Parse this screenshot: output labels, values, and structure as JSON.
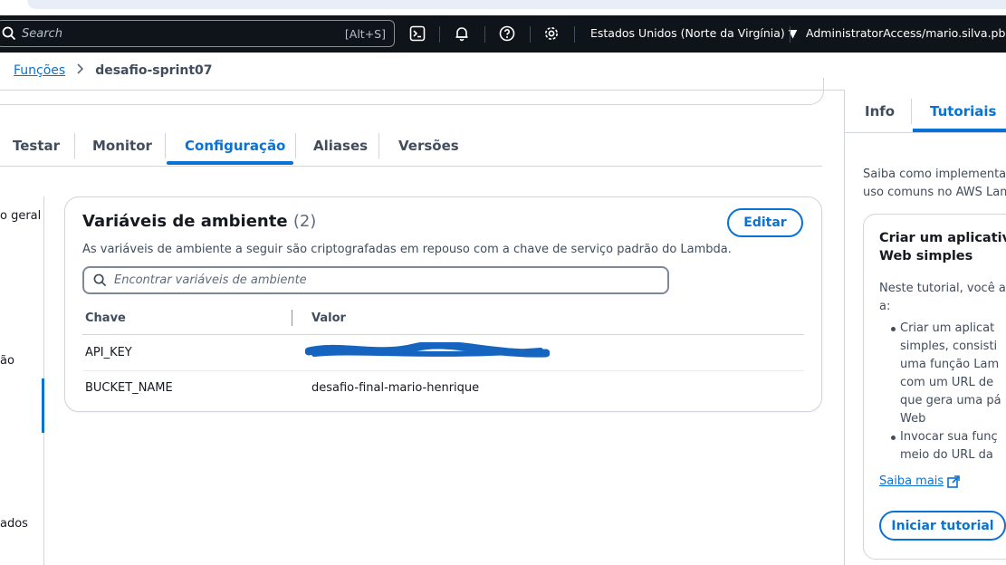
{
  "topnav": {
    "search_placeholder": "Search",
    "search_shortcut": "[Alt+S]",
    "region": "Estados Unidos (Norte da Virgínia) ▼",
    "account": "AdministratorAccess/mario.silva.pb@con"
  },
  "breadcrumb": {
    "parent": "Funções",
    "current": "desafio-sprint07"
  },
  "tabs": [
    "Testar",
    "Monitor",
    "Configuração",
    "Aliases",
    "Versões"
  ],
  "leftnav": [
    "o geral",
    "ão",
    "ados"
  ],
  "env": {
    "title": "Variáveis de ambiente",
    "count": "(2)",
    "description": "As variáveis de ambiente a seguir são criptografadas em repouso com a chave de serviço padrão do Lambda.",
    "edit_label": "Editar",
    "filter_placeholder": "Encontrar variáveis de ambiente",
    "col_key": "Chave",
    "col_value": "Valor",
    "rows": [
      {
        "key": "API_KEY",
        "value": ""
      },
      {
        "key": "BUCKET_NAME",
        "value": "desafio-final-mario-henrique"
      }
    ]
  },
  "help": {
    "tab_info": "Info",
    "tab_tutorials": "Tutoriais",
    "intro_line1": "Saiba como implementar",
    "intro_line2": "uso comuns no AWS Lam",
    "card_title_line1": "Criar um aplicativo",
    "card_title_line2": "Web simples",
    "card_desc_line1": "Neste tutorial, você ap",
    "card_desc_line2": "a:",
    "list": [
      "Criar um aplicat",
      "simples, consisti",
      "uma função Lam",
      "com um URL de",
      "que gera uma pá",
      "Web",
      "Invocar sua funç",
      "meio do URL da"
    ],
    "learn_more": "Saiba mais",
    "start_button": "Iniciar tutorial"
  },
  "colors": {
    "nav_bg": "#0f141a",
    "accent": "#0972d3",
    "redaction": "#1565c0"
  }
}
